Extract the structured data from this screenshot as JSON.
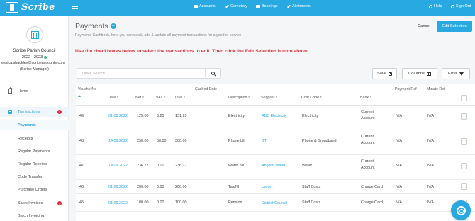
{
  "topbar": {
    "logo_text": "Scribe",
    "nav": [
      {
        "label": "Accounts",
        "icon": "accounts-icon"
      },
      {
        "label": "Cemetery",
        "icon": "pen-icon"
      },
      {
        "label": "Bookings",
        "icon": "bookings-icon"
      },
      {
        "label": "Allotments",
        "icon": "pen-icon"
      }
    ],
    "help": "Help",
    "signout": "Sign Out"
  },
  "sidebar": {
    "council_name": "Scribe Parish Council",
    "year": "2022 - 2023",
    "email": "jessica.shackley@scribeaccounts.com",
    "role": "(Scribe Manager)",
    "items": [
      {
        "label": "Home"
      },
      {
        "label": "Transactions",
        "badge": "2"
      },
      {
        "label": "Payments"
      },
      {
        "label": "Receipts"
      },
      {
        "label": "Regular Payments"
      },
      {
        "label": "Regular Receipts"
      },
      {
        "label": "Code Transfer"
      },
      {
        "label": "Purchase Orders"
      },
      {
        "label": "Sales Invoices",
        "badge": "1"
      },
      {
        "label": "Batch Invoicing"
      }
    ]
  },
  "main": {
    "title": "Payments",
    "subtitle": "Payments Cashbook, here you can detail, add & update all payment transactions for a good or service.",
    "cancel": "Cancel",
    "edit_selection": "Edit Selection",
    "instruction": "Use the checkboxes below to select the transactions to edit. Then click the Edit Selection button above",
    "search_placeholder": "Quick Search",
    "save": "Save",
    "columns": "Columns",
    "filter": "Filter"
  },
  "table": {
    "headers": [
      "VoucherNo",
      "Date",
      "Net",
      "VAT",
      "Total",
      "Cashed Date",
      "Description",
      "Supplier",
      "Cost Code",
      "Bank",
      "Payment Ref",
      "Minute Ref"
    ],
    "rows": [
      {
        "voucher": "49",
        "date": "01.09.2022",
        "net": "125.00",
        "vat": "6.25",
        "total": "131.25",
        "cashed": "",
        "desc": "Electricity",
        "supplier": "ABC Electricity",
        "cost": "Electricity",
        "bank1": "Current",
        "bank2": "Account",
        "payref": "N/A",
        "minref": "N/A"
      },
      {
        "voucher": "48",
        "date": "14.09.2022",
        "net": "250.00",
        "vat": "50.00",
        "total": "300.00",
        "cashed": "",
        "desc": "Phone bill",
        "supplier": "BT",
        "cost": "Phone & Broadband",
        "bank1": "Current",
        "bank2": "Account",
        "payref": "N/A",
        "minref": "N/A"
      },
      {
        "voucher": "47",
        "date": "14.09.2022",
        "net": "236.77",
        "vat": "0.00",
        "total": "236.77",
        "cashed": "",
        "desc": "Water bill",
        "supplier": "Anglian Water",
        "cost": "Water",
        "bank1": "Current",
        "bank2": "Account",
        "payref": "N/A",
        "minref": "N/A"
      },
      {
        "voucher": "46",
        "date": "01.09.2022",
        "net": "200.00",
        "vat": "0.00",
        "total": "200.00",
        "cashed": "",
        "desc": "Tax/NI",
        "supplier": "HMRC",
        "cost": "Staff Costs",
        "bank1": "Charge Card",
        "bank2": "",
        "payref": "N/A",
        "minref": "N/A"
      },
      {
        "voucher": "45",
        "date": "01.09.2022",
        "net": "100.00",
        "vat": "0.00",
        "total": "100.00",
        "cashed": "",
        "desc": "Pension",
        "supplier": "District Council",
        "cost": "Staff Costs",
        "bank1": "Charge Card",
        "bank2": "",
        "payref": "N/A",
        "minref": "N/A"
      }
    ]
  },
  "colors": {
    "accent": "#28a9e1",
    "danger": "#e0353d",
    "badge": "#e0283a",
    "online": "#35c36f"
  }
}
